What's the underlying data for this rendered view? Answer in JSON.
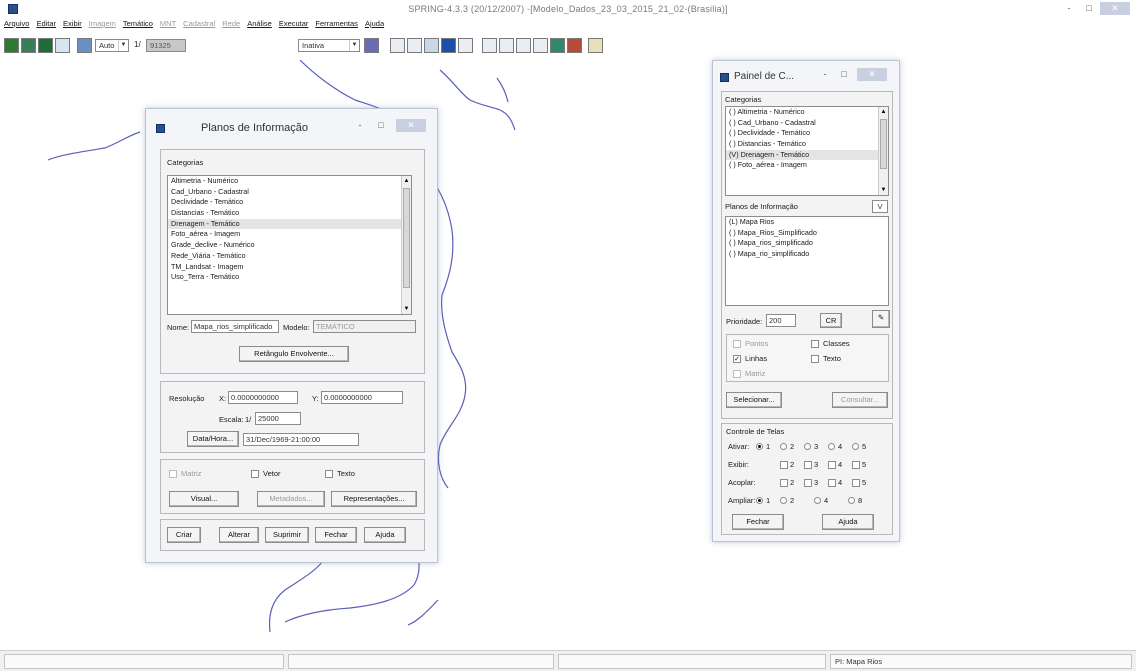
{
  "app": {
    "title": "SPRING-4.3.3 (20/12/2007) -[Modelo_Dados_23_03_2015_21_02-(Brasilia)]",
    "window_controls": [
      "-",
      "□",
      "✕"
    ]
  },
  "menubar": [
    {
      "label": "Arquivo",
      "enabled": true
    },
    {
      "label": "Editar",
      "enabled": true
    },
    {
      "label": "Exibir",
      "enabled": true
    },
    {
      "label": "Imagem",
      "enabled": false
    },
    {
      "label": "Temático",
      "enabled": true
    },
    {
      "label": "MNT",
      "enabled": false
    },
    {
      "label": "Cadastral",
      "enabled": false
    },
    {
      "label": "Rede",
      "enabled": false
    },
    {
      "label": "Análise",
      "enabled": true
    },
    {
      "label": "Executar",
      "enabled": true
    },
    {
      "label": "Ferramentas",
      "enabled": true
    },
    {
      "label": "Ajuda",
      "enabled": true
    }
  ],
  "toolbar": {
    "zoom_mode": "Auto",
    "scale_prefix": "1/",
    "scale_value": "91325",
    "mode": "Inativa"
  },
  "planos": {
    "title": "Planos de Informação",
    "controls": [
      "-",
      "□",
      "✕"
    ],
    "categorias_label": "Categorias",
    "categorias": [
      "Altimetria - Numérico",
      "Cad_Urbano - Cadastral",
      "Declividade - Temático",
      "Distancias - Temático",
      "Drenagem - Temático",
      "Foto_aérea - Imagem",
      "Grade_declive - Numérico",
      "Rede_Viária - Temático",
      "TM_Landsat - Imagem",
      "Uso_Terra - Temático"
    ],
    "selected_index": 4,
    "nome_label": "Nome:",
    "nome_value": "Mapa_rios_simplificado",
    "modelo_label": "Modelo:",
    "modelo_value": "TEMÁTICO",
    "retangulo_button": "Retângulo Envolvente...",
    "resolucao_label": "Resolução",
    "x_label": "X:",
    "x_value": "0.0000000000",
    "y_label": "Y:",
    "y_value": "0.0000000000",
    "escala_label": "Escala:",
    "escala_prefix": "1/",
    "escala_value": "25000",
    "datahora_button": "Data/Hora...",
    "datahora_value": "31/Dec/1969-21:00:00",
    "matriz_label": "Matriz",
    "vetor_label": "Vetor",
    "texto_label": "Texto",
    "visual_button": "Visual...",
    "metadados_button": "Metadados...",
    "representacoes_button": "Representações...",
    "buttons": [
      "Criar",
      "Alterar",
      "Suprimir",
      "Fechar",
      "Ajuda"
    ]
  },
  "painel": {
    "title": "Painel de C...",
    "controls": [
      "-",
      "□",
      "✕"
    ],
    "categorias_label": "Categorias",
    "categorias": [
      "( ) Altimetria - Numérico",
      "( ) Cad_Urbano - Cadastral",
      "( ) Declividade - Temático",
      "( ) Distancias - Temático",
      "(V) Drenagem - Temático",
      "( ) Foto_aérea - Imagem"
    ],
    "selected_index": 4,
    "planos_label": "Planos de Informação",
    "planos_dropdown": "V",
    "planos": [
      "(L) Mapa Rios",
      "( ) Mapa_Rios_Simplificado",
      "( ) Mapa_rios_simplificado",
      "( ) Mapa_rio_simplificado"
    ],
    "prioridade_label": "Prioridade:",
    "prioridade_value": "200",
    "cr_button": "CR",
    "pontos_label": "Pontos",
    "classes_label": "Classes",
    "linhas_label": "Linhas",
    "texto_label": "Texto",
    "matriz_label": "Matriz",
    "selecionar_button": "Selecionar...",
    "consultar_button": "Consultar...",
    "controle_label": "Controle de Telas",
    "ativar_label": "Ativar:",
    "exibir_label": "Exibir:",
    "acoplar_label": "Acoplar:",
    "ampliar_label": "Ampliar:",
    "tela_numbers": [
      "1",
      "2",
      "3",
      "4",
      "5"
    ],
    "ampliar_numbers": [
      "1",
      "2",
      "4",
      "8"
    ],
    "fechar_button": "Fechar",
    "ajuda_button": "Ajuda"
  },
  "statusbar": {
    "pi_label": "PI: Mapa Rios"
  },
  "colors": {
    "vector_lines": "#5a5fb8",
    "title_text": "#7a7a7a",
    "window_border": "#b9c3d4"
  }
}
